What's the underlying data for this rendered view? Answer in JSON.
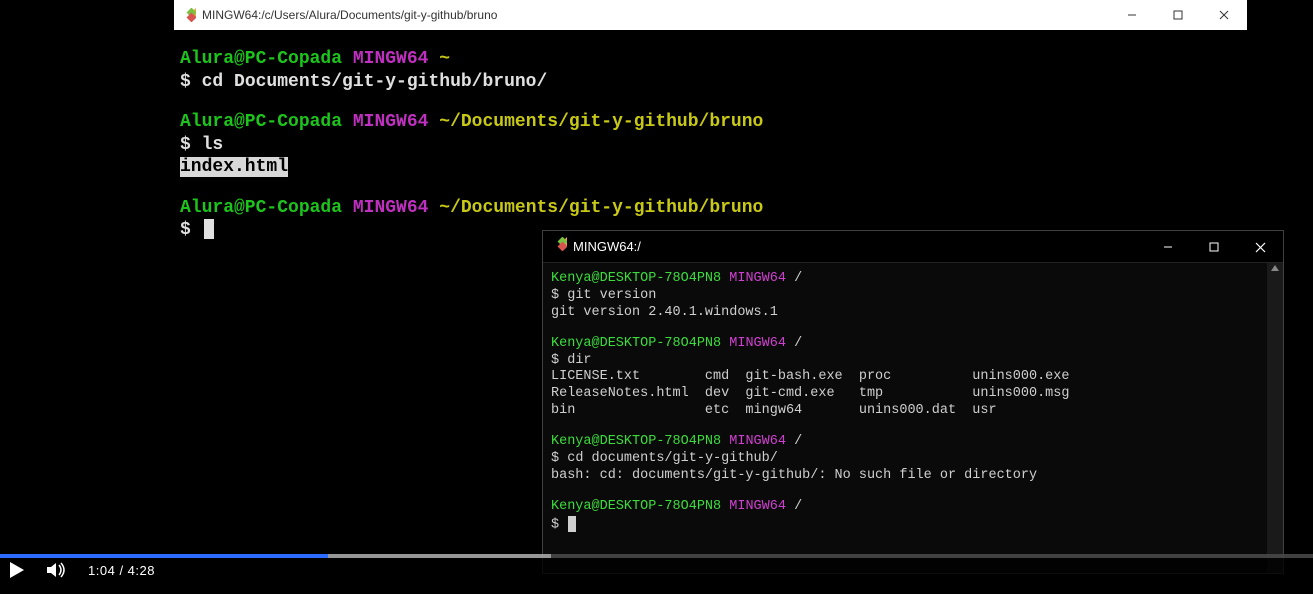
{
  "bg": {
    "title": "MINGW64:/c/Users/Alura/Documents/git-y-github/bruno",
    "p1": {
      "user": "Alura@PC-Copada",
      "sys": "MINGW64",
      "path": "~"
    },
    "cmd1": "cd Documents/git-y-github/bruno/",
    "p2": {
      "user": "Alura@PC-Copada",
      "sys": "MINGW64",
      "path": "~/Documents/git-y-github/bruno"
    },
    "cmd2": "ls",
    "out2": "index.html",
    "p3": {
      "user": "Alura@PC-Copada",
      "sys": "MINGW64",
      "path": "~/Documents/git-y-github/bruno"
    },
    "prompt_char": "$"
  },
  "fg": {
    "title": "MINGW64:/",
    "p1": {
      "user": "Kenya@DESKTOP-78O4PN8",
      "sys": "MINGW64",
      "path": "/"
    },
    "cmd1": "git version",
    "out1": "git version 2.40.1.windows.1",
    "p2": {
      "user": "Kenya@DESKTOP-78O4PN8",
      "sys": "MINGW64",
      "path": "/"
    },
    "cmd2": "dir",
    "out2": "LICENSE.txt        cmd  git-bash.exe  proc          unins000.exe\nReleaseNotes.html  dev  git-cmd.exe   tmp           unins000.msg\nbin                etc  mingw64       unins000.dat  usr",
    "p3": {
      "user": "Kenya@DESKTOP-78O4PN8",
      "sys": "MINGW64",
      "path": "/"
    },
    "cmd3": "cd documents/git-y-github/",
    "out3": "bash: cd: documents/git-y-github/: No such file or directory",
    "p4": {
      "user": "Kenya@DESKTOP-78O4PN8",
      "sys": "MINGW64",
      "path": "/"
    },
    "prompt_char": "$"
  },
  "video": {
    "current": "1:04",
    "duration": "4:28",
    "buffer_pct": 42,
    "play_pct": 25
  }
}
